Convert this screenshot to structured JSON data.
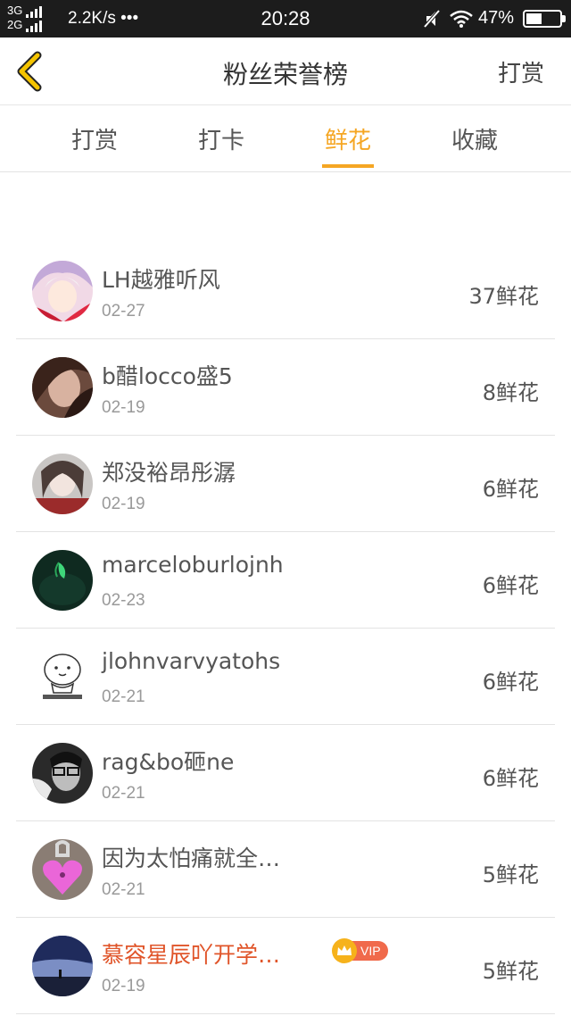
{
  "status_bar": {
    "net_top": "3G",
    "net_bottom": "2G",
    "speed": "2.2K/s •••",
    "time": "20:28",
    "battery_pct": "47%",
    "icons": [
      "signal-icon",
      "mute-icon",
      "wifi-icon",
      "battery-icon"
    ]
  },
  "nav": {
    "title": "粉丝荣誉榜",
    "right_action": "打赏",
    "back_icon": "chevron-left-icon",
    "accent": "#f5a623"
  },
  "tabs": [
    {
      "label": "打赏",
      "active": false
    },
    {
      "label": "打卡",
      "active": false
    },
    {
      "label": "鲜花",
      "active": true
    },
    {
      "label": "收藏",
      "active": false
    }
  ],
  "fans": [
    {
      "name": "LH越雅听风",
      "date": "02-27",
      "count": "37鲜花",
      "vip": false
    },
    {
      "name": "b醋locco盛5",
      "date": "02-19",
      "count": "8鲜花",
      "vip": false
    },
    {
      "name": "郑没裕昂彤潺",
      "date": "02-19",
      "count": "6鲜花",
      "vip": false
    },
    {
      "name": "marceloburlojnh",
      "date": "02-23",
      "count": "6鲜花",
      "vip": false
    },
    {
      "name": "jlohnvarvyatohs",
      "date": "02-21",
      "count": "6鲜花",
      "vip": false
    },
    {
      "name": "rag&bo砸ne",
      "date": "02-21",
      "count": "6鲜花",
      "vip": false
    },
    {
      "name": "因为太怕痛就全…",
      "date": "02-21",
      "count": "5鲜花",
      "vip": false
    },
    {
      "name": "慕容星辰吖开学…",
      "date": "02-19",
      "count": "5鲜花",
      "vip": true,
      "vip_label": "VIP"
    }
  ]
}
